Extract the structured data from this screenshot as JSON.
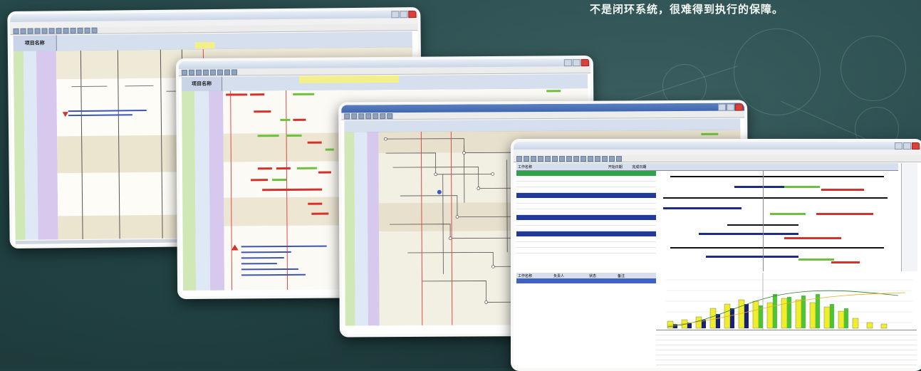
{
  "headline": "不是闭环系统，很难得到执行的保障。",
  "windows": {
    "w1": {
      "col_header": "项目名称"
    },
    "w2": {
      "col_header": "项目名称"
    },
    "w4": {
      "table_cols": [
        "工作名称",
        "开始日期",
        "完成日期"
      ],
      "footer_cols": [
        "工作名称",
        "负责人",
        "状态",
        "备注"
      ]
    }
  },
  "colors": {
    "board": "#1f3d3f",
    "bar_red": "#d8312b",
    "bar_green": "#6cc23c",
    "bar_blue": "#1c2a8a",
    "chart_yellow": "#f0ee2a",
    "chart_green": "#4cc434",
    "chart_navy": "#17207a",
    "lane_purple": "#d7c9ee",
    "lane_green": "#cfe8b5"
  }
}
